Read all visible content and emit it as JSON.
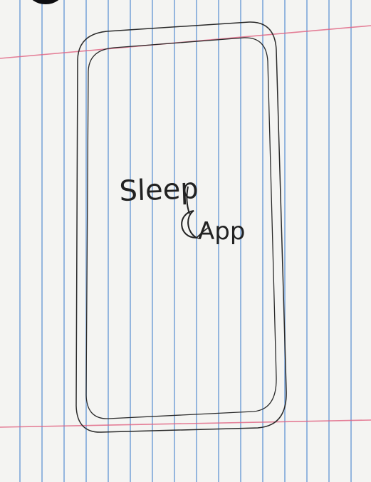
{
  "sketch": {
    "title_word_1": "Sleep",
    "title_word_2": "App",
    "logo_icon": "crescent-moon-icon",
    "colors": {
      "paper": "#f4f4f2",
      "rule_line": "#4682cd",
      "margin_line": "#e06080",
      "pencil": "#222222"
    }
  }
}
